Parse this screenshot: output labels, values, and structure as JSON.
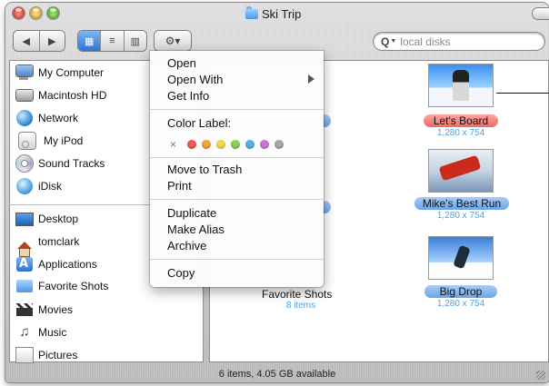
{
  "window": {
    "title": "Ski Trip"
  },
  "toolbar": {
    "back_glyph": "◀",
    "forward_glyph": "▶",
    "view_icon_glyph": "▦",
    "view_list_glyph": "≡",
    "view_column_glyph": "▥",
    "action_glyph": "⚙▾"
  },
  "search": {
    "placeholder": "local disks"
  },
  "sidebar": {
    "devices": [
      {
        "label": "My Computer",
        "icon": "computer-icon"
      },
      {
        "label": "Macintosh HD",
        "icon": "hard-disk-icon"
      },
      {
        "label": "Network",
        "icon": "network-globe-icon"
      },
      {
        "label": "My iPod",
        "icon": "ipod-icon"
      },
      {
        "label": "Sound Tracks",
        "icon": "cd-icon"
      },
      {
        "label": "iDisk",
        "icon": "idisk-icon"
      }
    ],
    "places": [
      {
        "label": "Desktop",
        "icon": "desktop-icon"
      },
      {
        "label": "tomclark",
        "icon": "home-icon"
      },
      {
        "label": "Applications",
        "icon": "applications-icon"
      },
      {
        "label": "Favorite Shots",
        "icon": "folder-icon"
      },
      {
        "label": "Movies",
        "icon": "movies-icon"
      },
      {
        "label": "Music",
        "icon": "music-icon"
      },
      {
        "label": "Pictures",
        "icon": "pictures-icon"
      }
    ]
  },
  "content": {
    "items": [
      {
        "name": "Let's Board",
        "detail": "1,280 x 754",
        "label_color": "#f06a63"
      },
      {
        "name": "Mike's Best Run",
        "detail": "1,280 x 754",
        "label_color": "#6aa4e6"
      },
      {
        "name": "Big Drop",
        "detail": "1,280 x 754",
        "label_color": "#6aa4e6"
      },
      {
        "name": "Favorite Shots",
        "detail": "8 items"
      }
    ]
  },
  "status": {
    "text": "6 items, 4.05 GB available"
  },
  "context_menu": {
    "open": "Open",
    "open_with": "Open With",
    "get_info": "Get Info",
    "color_label": "Color Label:",
    "clear_label_glyph": "×",
    "colors": [
      "#f35a4f",
      "#f7a237",
      "#f3d84a",
      "#8fd14f",
      "#4fb7e8",
      "#c879d6",
      "#a8a8a8"
    ],
    "move_to_trash": "Move to Trash",
    "print": "Print",
    "duplicate": "Duplicate",
    "make_alias": "Make Alias",
    "archive": "Archive",
    "copy": "Copy"
  }
}
